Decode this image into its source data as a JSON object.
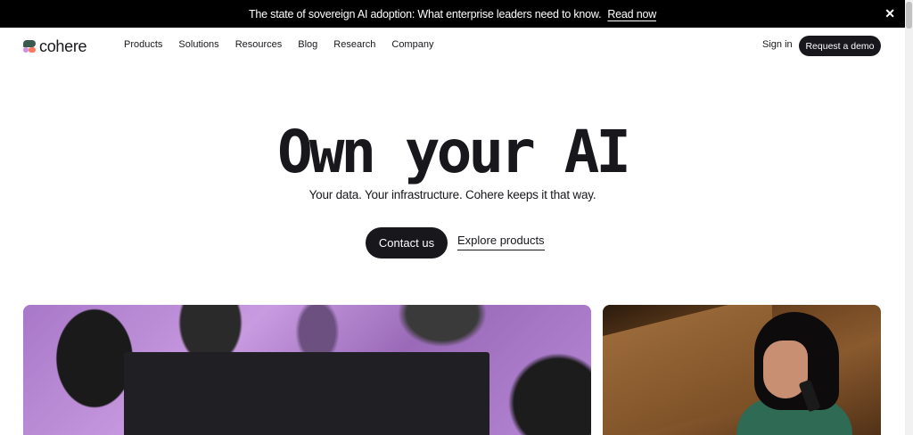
{
  "announcement": {
    "text": "The state of sovereign AI adoption: What enterprise leaders need to know.",
    "link_label": "Read now",
    "close_icon": "close-icon"
  },
  "nav": {
    "logo_text": "cohere",
    "items": [
      {
        "label": "Products"
      },
      {
        "label": "Solutions"
      },
      {
        "label": "Resources"
      },
      {
        "label": "Blog"
      },
      {
        "label": "Research"
      },
      {
        "label": "Company"
      }
    ],
    "sign_in": "Sign in",
    "cta": "Request a demo"
  },
  "hero": {
    "title": "Own your AI",
    "subtitle": "Your data. Your infrastructure. Cohere keeps it that way.",
    "primary_button": "Contact us",
    "secondary_link": "Explore products"
  },
  "colors": {
    "text": "#17171c",
    "announce_bg": "#000000",
    "button_bg": "#17171c",
    "logo_green": "#39594d",
    "logo_pink": "#d18ee2",
    "logo_coral": "#ff7759"
  }
}
